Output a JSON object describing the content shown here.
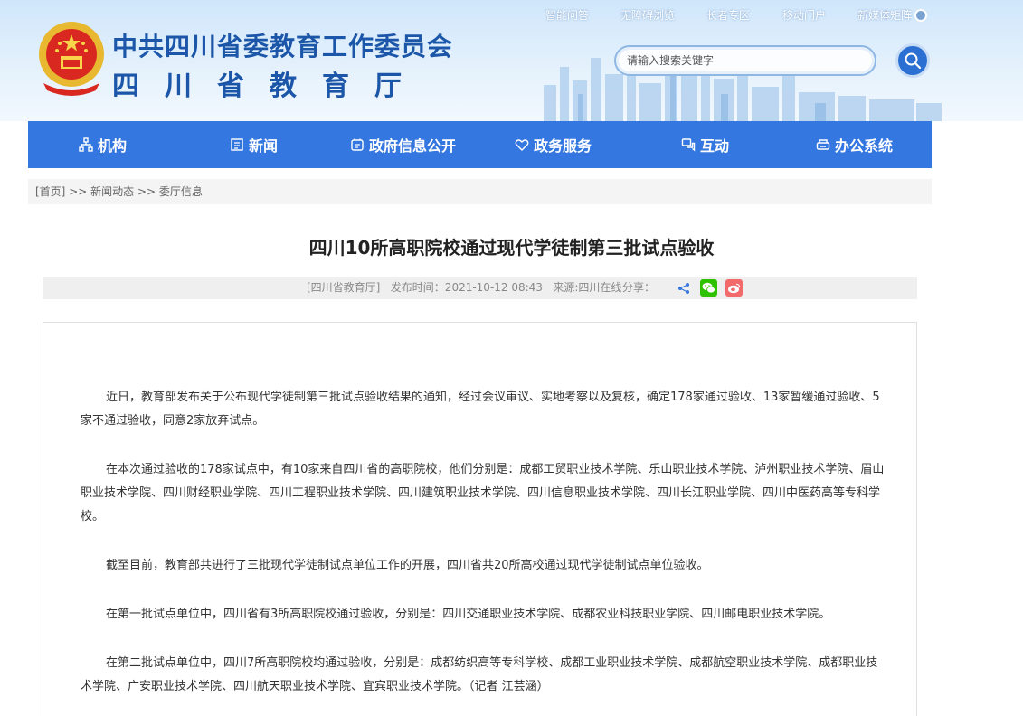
{
  "header": {
    "org_title": "中共四川省委教育工作委员会",
    "org_subtitle": "四川省教育厅",
    "top_links": [
      "智能问答",
      "无障碍浏览",
      "长者专区",
      "移动门户",
      "新媒体矩阵"
    ],
    "search_placeholder": "请输入搜索关键字"
  },
  "nav": {
    "items": [
      {
        "label": "机构",
        "icon": "org-chart-icon"
      },
      {
        "label": "新闻",
        "icon": "news-icon"
      },
      {
        "label": "政府信息公开",
        "icon": "info-disclosure-icon"
      },
      {
        "label": "政务服务",
        "icon": "service-icon"
      },
      {
        "label": "互动",
        "icon": "interaction-icon"
      },
      {
        "label": "办公系统",
        "icon": "office-icon"
      }
    ]
  },
  "breadcrumb": {
    "home": "[首页]",
    "sep": " >> ",
    "level1": "新闻动态",
    "level2": "委厅信息"
  },
  "article": {
    "title": "四川10所高职院校通过现代学徒制第三批试点验收",
    "meta": "[四川省教育厅]   发布时间：2021-10-12 08:43   来源:四川在线",
    "share_label": "分享：",
    "paragraphs": [
      "近日，教育部发布关于公布现代学徒制第三批试点验收结果的通知，经过会议审议、实地考察以及复核，确定178家通过验收、13家暂缓通过验收、5家不通过验收，同意2家放弃试点。",
      "在本次通过验收的178家试点中，有10家来自四川省的高职院校，他们分别是：成都工贸职业技术学院、乐山职业技术学院、泸州职业技术学院、眉山职业技术学院、四川财经职业学院、四川工程职业技术学院、四川建筑职业技术学院、四川信息职业技术学院、四川长江职业学院、四川中医药高等专科学校。",
      "截至目前，教育部共进行了三批现代学徒制试点单位工作的开展，四川省共20所高校通过现代学徒制试点单位验收。",
      "在第一批试点单位中，四川省有3所高职院校通过验收，分别是：四川交通职业技术学院、成都农业科技职业学院、四川邮电职业技术学院。",
      "在第二批试点单位中，四川7所高职院校均通过验收，分别是：成都纺织高等专科学校、成都工业职业技术学院、成都航空职业技术学院、成都职业技术学院、广安职业技术学院、四川航天职业技术学院、宜宾职业技术学院。（记者  江芸涵）"
    ]
  },
  "colors": {
    "nav_bg": "#3577e0",
    "title_blue": "#1b56a8",
    "wechat_green": "#2dc100",
    "weibo_red": "#f26a6a"
  }
}
